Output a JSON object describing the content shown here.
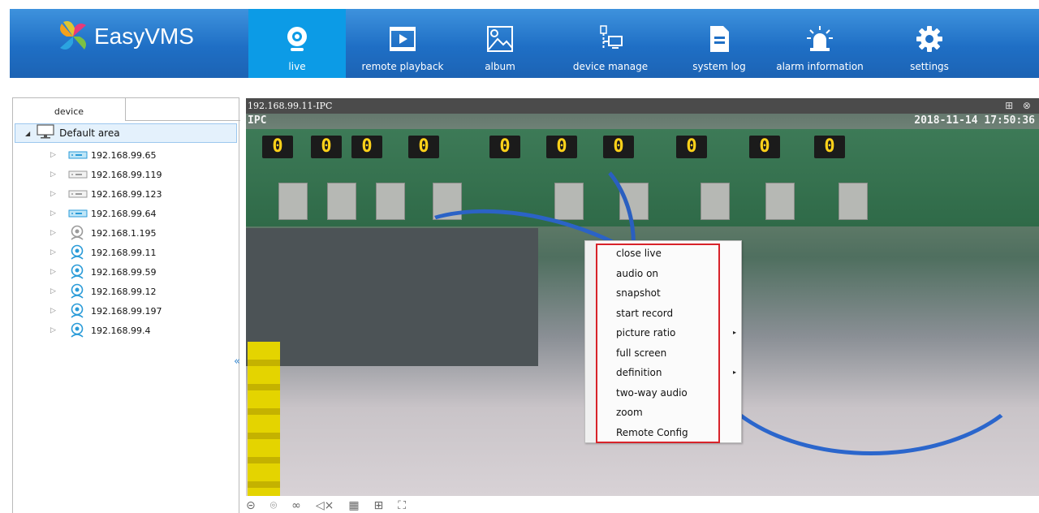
{
  "app": {
    "name": "EasyVMS"
  },
  "nav": [
    {
      "label": "live",
      "icon": "webcam-icon",
      "active": true
    },
    {
      "label": "remote playback",
      "icon": "play-film-icon",
      "active": false
    },
    {
      "label": "album",
      "icon": "image-icon",
      "active": false
    },
    {
      "label": "device manage",
      "icon": "device-network-icon",
      "active": false
    },
    {
      "label": "system log",
      "icon": "document-icon",
      "active": false
    },
    {
      "label": "alarm information",
      "icon": "alarm-siren-icon",
      "active": false
    },
    {
      "label": "settings",
      "icon": "gear-icon",
      "active": false
    }
  ],
  "sidebar": {
    "tab_label": "device",
    "root": {
      "label": "Default area",
      "icon": "monitor-icon",
      "expanded": true
    },
    "devices": [
      {
        "label": "192.168.99.65",
        "icon": "nvr-icon",
        "online": true
      },
      {
        "label": "192.168.99.119",
        "icon": "nvr-icon",
        "online": false
      },
      {
        "label": "192.168.99.123",
        "icon": "nvr-icon",
        "online": false
      },
      {
        "label": "192.168.99.64",
        "icon": "nvr-icon",
        "online": true
      },
      {
        "label": "192.168.1.195",
        "icon": "camera-icon",
        "online": false
      },
      {
        "label": "192.168.99.11",
        "icon": "camera-icon",
        "online": true
      },
      {
        "label": "192.168.99.59",
        "icon": "camera-icon",
        "online": true
      },
      {
        "label": "192.168.99.12",
        "icon": "camera-icon",
        "online": true
      },
      {
        "label": "192.168.99.197",
        "icon": "camera-icon",
        "online": true
      },
      {
        "label": "192.168.99.4",
        "icon": "camera-icon",
        "online": true
      }
    ],
    "collapse_glyph": "«"
  },
  "video": {
    "title": "192.168.99.11-IPC",
    "osd_name": "IPC",
    "osd_timestamp": "2018-11-14 17:50:36",
    "window_controls": "⊞ ⊗"
  },
  "context_menu": {
    "items": [
      {
        "label": "close live",
        "submenu": false
      },
      {
        "label": "audio on",
        "submenu": false
      },
      {
        "label": "snapshot",
        "submenu": false
      },
      {
        "label": "start record",
        "submenu": false
      },
      {
        "label": "picture ratio",
        "submenu": true
      },
      {
        "label": "full screen",
        "submenu": false
      },
      {
        "label": "definition",
        "submenu": true
      },
      {
        "label": "two-way audio",
        "submenu": false
      },
      {
        "label": "zoom",
        "submenu": false
      },
      {
        "label": "Remote Config",
        "submenu": false
      }
    ],
    "highlight_color": "#d8232a",
    "submenu_glyph": "▸"
  },
  "toolbar": {
    "buttons": [
      {
        "icon": "stop-icon",
        "glyph": "⊝"
      },
      {
        "icon": "snapshot-icon",
        "glyph": "⌾"
      },
      {
        "icon": "record-icon",
        "glyph": "∞"
      },
      {
        "icon": "mute-icon",
        "glyph": "◁×"
      },
      {
        "icon": "grid-icon",
        "glyph": "▦"
      },
      {
        "icon": "layout-icon",
        "glyph": "⊞"
      },
      {
        "icon": "fullscreen-icon",
        "glyph": "⛶"
      }
    ]
  },
  "colors": {
    "header": "#1f6fc5",
    "active_tab": "#0c9be6",
    "selected_row": "#e4f1fc"
  }
}
